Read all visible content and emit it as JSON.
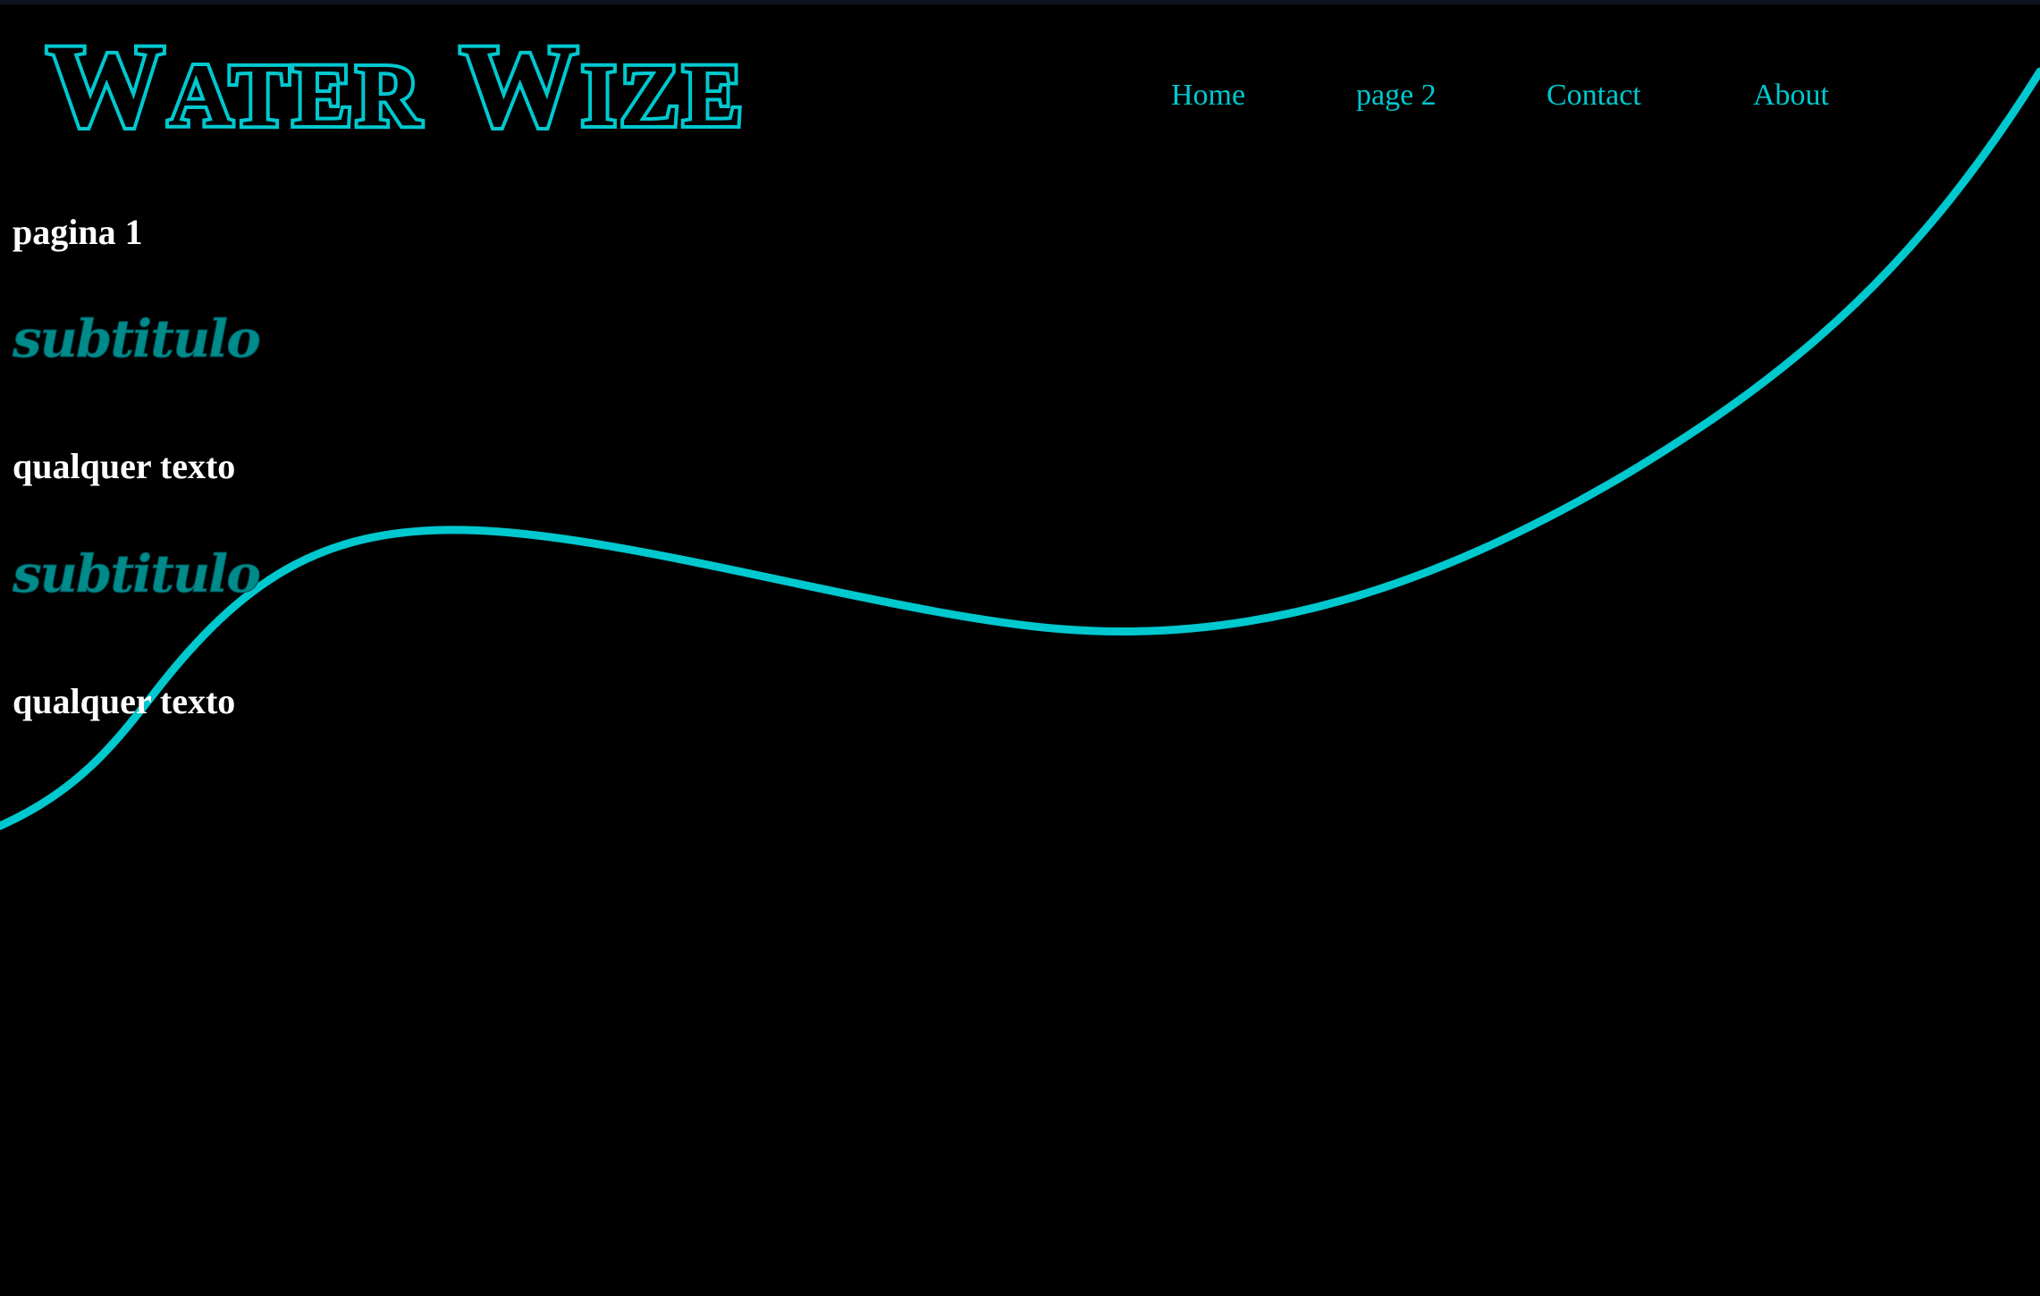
{
  "colors": {
    "background": "#000000",
    "accent": "#00c8cf",
    "subtitle": "#008b8b",
    "text": "#ffffff"
  },
  "logo": {
    "word1_initial": "W",
    "word1_rest": "ATER",
    "word2_initial": "W",
    "word2_rest": "IZE"
  },
  "nav": {
    "items": [
      "Home",
      "page 2",
      "Contact",
      "About"
    ]
  },
  "content": {
    "page_title": "pagina 1",
    "sections": [
      {
        "subtitle": "subtitulo",
        "text": "qualquer texto"
      },
      {
        "subtitle": "subtitulo",
        "text": "qualquer texto"
      }
    ]
  }
}
